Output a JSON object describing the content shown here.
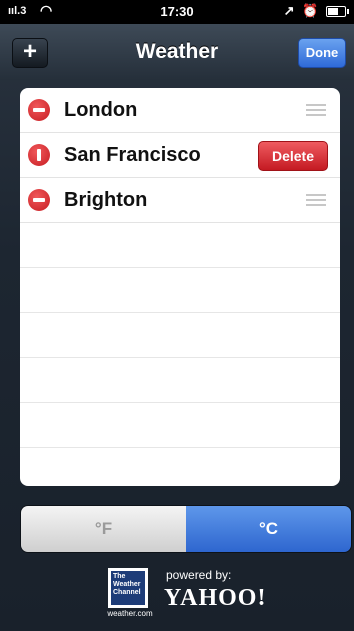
{
  "status": {
    "carrier": "ııl.3",
    "time": "17:30",
    "indicators": "↗ ⏰",
    "battery_level": 0.7
  },
  "nav": {
    "title": "Weather",
    "add_label": "+",
    "done_label": "Done"
  },
  "cities": [
    {
      "name": "London",
      "state": "normal"
    },
    {
      "name": "San Francisco",
      "state": "delete-confirm",
      "delete_label": "Delete"
    },
    {
      "name": "Brighton",
      "state": "normal"
    }
  ],
  "units": {
    "fahrenheit": "°F",
    "celsius": "°C",
    "selected": "°C"
  },
  "footer": {
    "twc_logo_text": "The Weather Channel",
    "twc_url": "weather.com",
    "powered_by": "powered by:",
    "yahoo": "YAHOO!"
  },
  "colors": {
    "delete_red": "#d32a30",
    "accent_blue": "#2e66cf",
    "navbar": "#2a3440"
  }
}
